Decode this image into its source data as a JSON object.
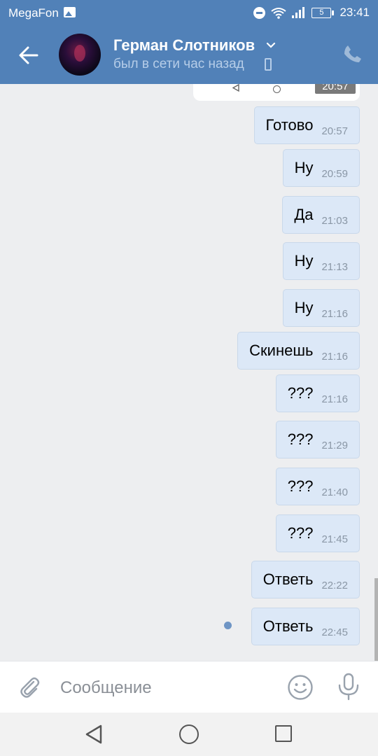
{
  "status_bar": {
    "carrier": "MegaFon",
    "battery": "5",
    "time": "23:41"
  },
  "header": {
    "contact_name": "Герман Слотников",
    "last_seen": "был в сети час назад",
    "accent_color": "#5181b8"
  },
  "chat": {
    "previous_card_time": "20:57",
    "messages": [
      {
        "text": "Готово",
        "time": "20:57"
      },
      {
        "text": "Ну",
        "time": "20:59"
      },
      {
        "text": "Да",
        "time": "21:03"
      },
      {
        "text": "Ну",
        "time": "21:13"
      },
      {
        "text": "Ну",
        "time": "21:16"
      },
      {
        "text": "Скинешь",
        "time": "21:16"
      },
      {
        "text": "???",
        "time": "21:16"
      },
      {
        "text": "???",
        "time": "21:29"
      },
      {
        "text": "???",
        "time": "21:40"
      },
      {
        "text": "???",
        "time": "21:45"
      },
      {
        "text": "Ответь",
        "time": "22:22"
      },
      {
        "text": "Ответь",
        "time": "22:45",
        "unread": true
      }
    ],
    "bubble_color": "#dce8f7"
  },
  "composer": {
    "placeholder": "Сообщение"
  }
}
